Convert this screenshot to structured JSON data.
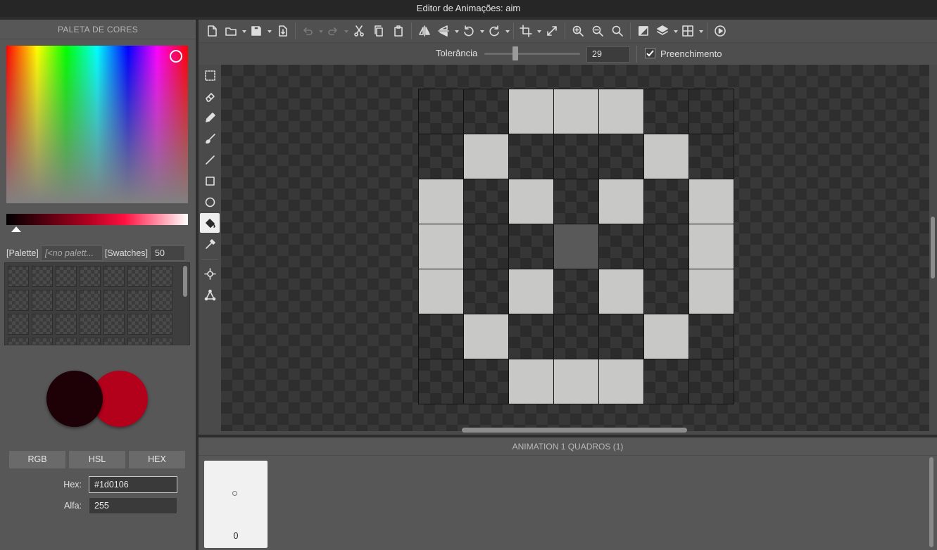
{
  "window": {
    "title": "Editor de Animações: aim"
  },
  "palette_panel": {
    "header": "PALETA DE CORES",
    "palette_label": "[Palette]",
    "palette_name": "[<no palett...",
    "swatches_label": "[Swatches]",
    "swatches_count": "50",
    "primary_color": "#1d0106",
    "secondary_color": "#b3001b",
    "modes": [
      "RGB",
      "HSL",
      "HEX"
    ],
    "hex_label": "Hex:",
    "hex_value": "#1d0106",
    "alpha_label": "Alfa:",
    "alpha_value": "255"
  },
  "toolbar": {
    "icons": [
      "new-file-icon",
      "open-folder-icon",
      "save-icon",
      "export-icon",
      "undo-icon",
      "redo-icon",
      "cut-icon",
      "copy-icon",
      "paste-icon",
      "flip-horizontal-icon",
      "flip-vertical-icon",
      "rotate-left-icon",
      "rotate-right-icon",
      "crop-icon",
      "resize-icon",
      "zoom-in-icon",
      "zoom-out-icon",
      "zoom-reset-icon",
      "background-icon",
      "layers-icon",
      "grid-icon",
      "play-icon"
    ]
  },
  "options_bar": {
    "tolerance_label": "Tolerância",
    "tolerance_value": "29",
    "tolerance_fraction": 0.29,
    "fill_label": "Preenchimento",
    "fill_checked": true
  },
  "tools": [
    "selection-icon",
    "eraser-icon",
    "pencil-icon",
    "brush-icon",
    "line-icon",
    "rectangle-icon",
    "ellipse-icon",
    "fill-bucket-icon",
    "eyedropper-icon",
    "origin-icon",
    "bone-icon"
  ],
  "active_tool": "fill-bucket-icon",
  "sprite": {
    "columns": 7,
    "rows": 7,
    "colors": {
      "c1": "#c8c8c6",
      "c2": "#595959"
    },
    "pixels": [
      [
        0,
        0,
        1,
        1,
        1,
        0,
        0
      ],
      [
        0,
        1,
        0,
        0,
        0,
        1,
        0
      ],
      [
        1,
        0,
        1,
        0,
        1,
        0,
        1
      ],
      [
        1,
        0,
        0,
        2,
        0,
        0,
        1
      ],
      [
        1,
        0,
        1,
        0,
        1,
        0,
        1
      ],
      [
        0,
        1,
        0,
        0,
        0,
        1,
        0
      ],
      [
        0,
        0,
        1,
        1,
        1,
        0,
        0
      ]
    ]
  },
  "frames_panel": {
    "header": "ANIMATION 1 QUADROS (1)",
    "frames": [
      {
        "number": "0"
      }
    ]
  }
}
